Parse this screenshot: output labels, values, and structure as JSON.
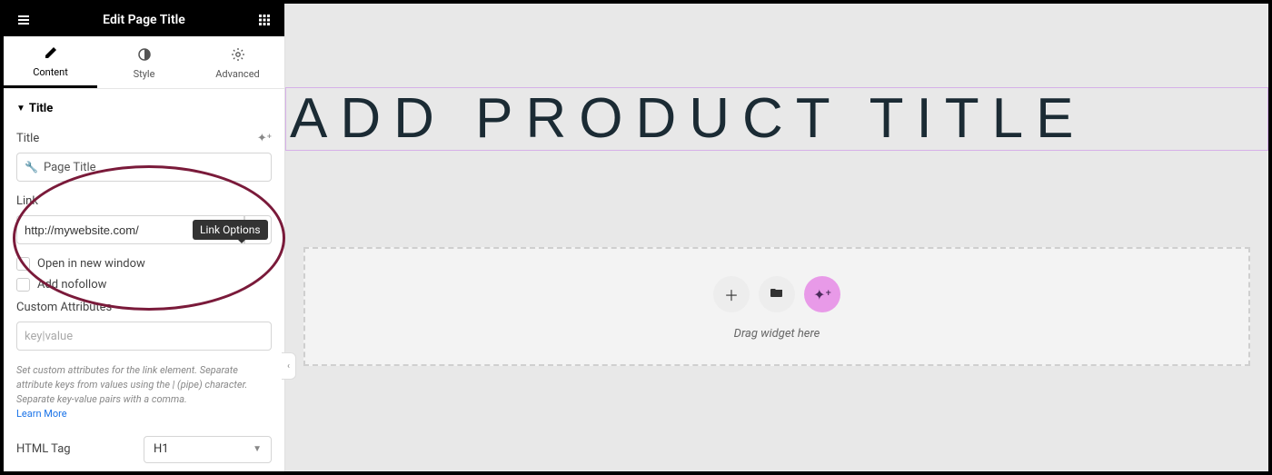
{
  "header": {
    "title": "Edit Page Title"
  },
  "tabs": {
    "content": "Content",
    "style": "Style",
    "advanced": "Advanced"
  },
  "section": {
    "title": "Title"
  },
  "fields": {
    "title_label": "Title",
    "title_value": "Page Title",
    "link_label": "Link",
    "link_value": "http://mywebsite.com/",
    "link_tooltip": "Link Options",
    "open_new_window": "Open in new window",
    "add_nofollow": "Add nofollow",
    "custom_attr_label": "Custom Attributes",
    "custom_attr_placeholder": "key|value",
    "custom_attr_help": "Set custom attributes for the link element. Separate attribute keys from values using the | (pipe) character. Separate key-value pairs with a comma.",
    "learn_more": "Learn More",
    "html_tag_label": "HTML Tag",
    "html_tag_value": "H1"
  },
  "canvas": {
    "title_text": "ADD PRODUCT TITLE",
    "drop_text": "Drag widget here"
  }
}
